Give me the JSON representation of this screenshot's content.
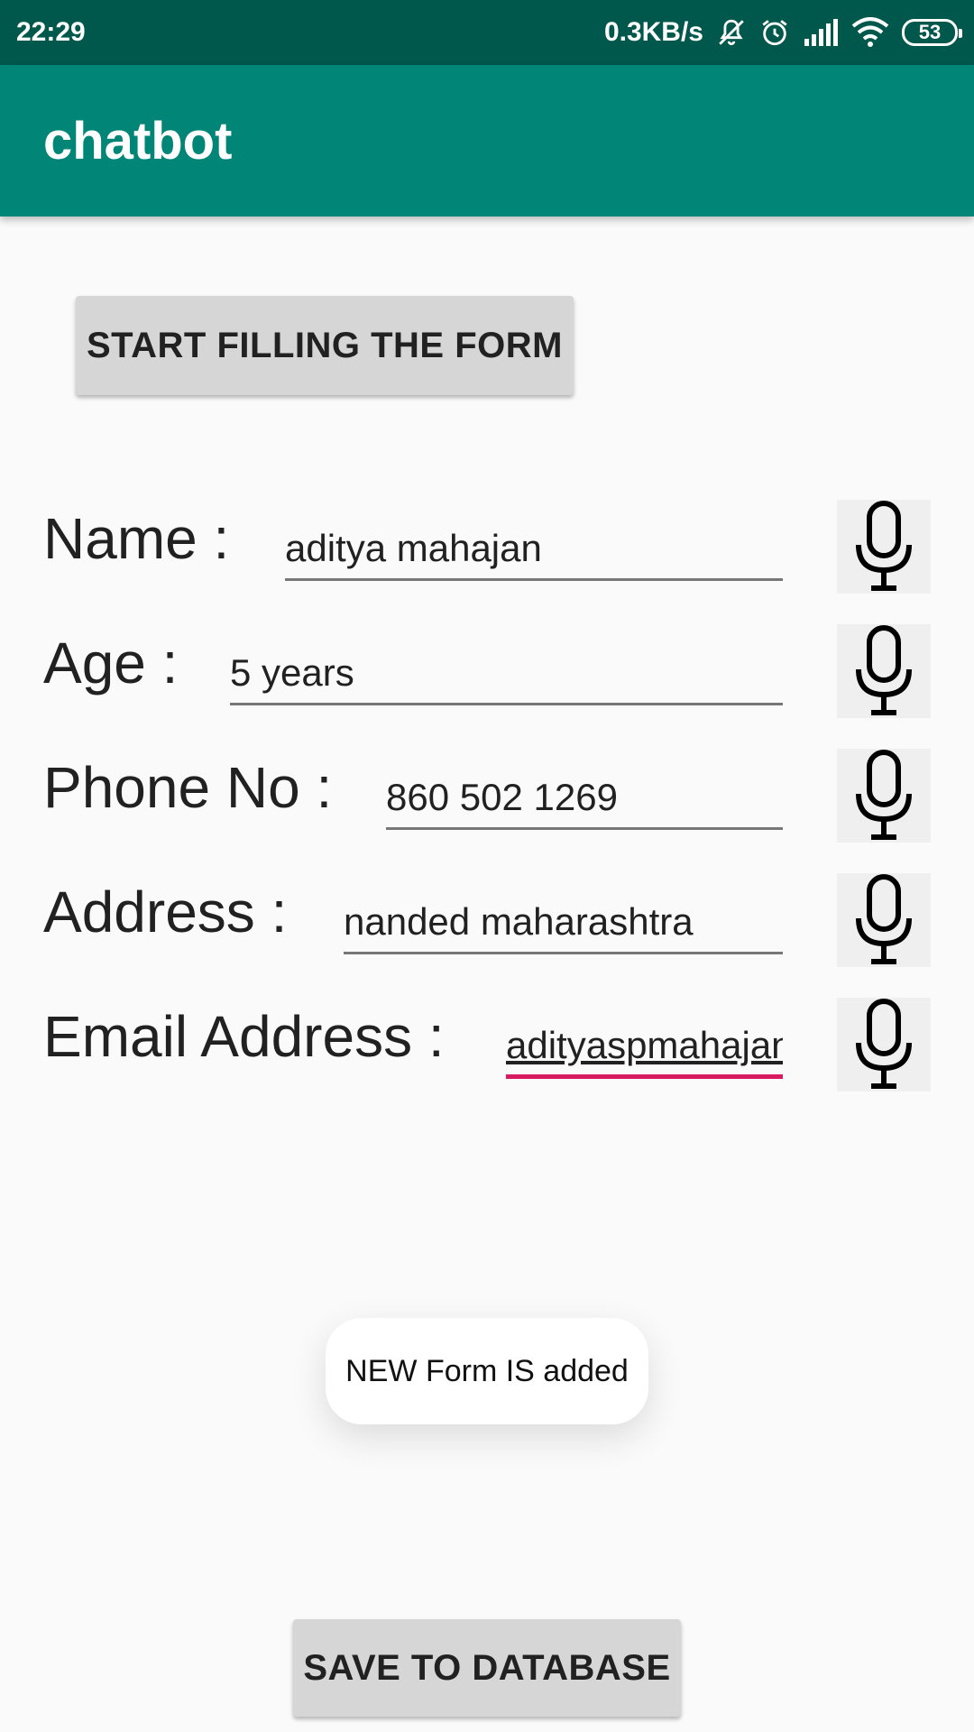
{
  "status_bar": {
    "time": "22:29",
    "net_speed": "0.3KB/s",
    "battery": "53"
  },
  "app_bar": {
    "title": "chatbot"
  },
  "start_button": {
    "label": "START FILLING THE FORM"
  },
  "form": {
    "name": {
      "label": "Name :",
      "value": "aditya mahajan"
    },
    "age": {
      "label": "Age :",
      "value": "5 years"
    },
    "phone": {
      "label": "Phone No :",
      "value": "860 502 1269"
    },
    "address": {
      "label": "Address :",
      "value": "nanded maharashtra"
    },
    "email": {
      "label": "Email Address :",
      "value": "adityaspmahajan"
    }
  },
  "toast": {
    "message": "NEW Form IS added"
  },
  "save_button": {
    "label": "SAVE TO DATABASE"
  },
  "colors": {
    "primary": "#008577",
    "primary_dark": "#00574b",
    "accent": "#d81b60"
  }
}
